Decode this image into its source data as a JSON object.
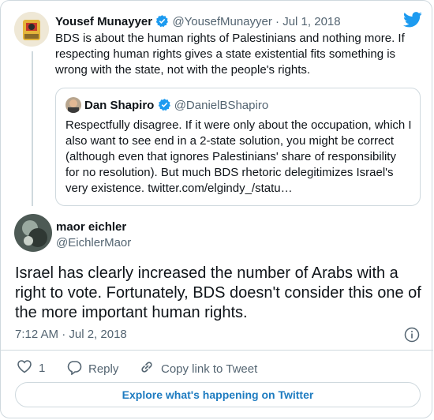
{
  "parent_tweet": {
    "display_name": "Yousef Munayyer",
    "handle": "@YousefMunayyer",
    "date": "Jul 1, 2018",
    "separator": "·",
    "text": "BDS is about the human rights of Palestinians and nothing more. If respecting human rights gives a state existential fits something is wrong with the state, not with the people's rights."
  },
  "quoted_tweet": {
    "display_name": "Dan Shapiro",
    "handle": "@DanielBShapiro",
    "text": "Respectfully disagree. If it were only about the occupation, which I also want to see end in a 2-state solution, you might be correct (although even that ignores Palestinians' share of responsibility for no resolution). But much BDS rhetoric delegitimizes Israel's very existence. twitter.com/elgindy_/statu…"
  },
  "main_tweet": {
    "display_name": "maor eichler",
    "handle": "@EichlerMaor",
    "text": "Israel has clearly increased the number of Arabs with a right to vote. Fortunately, BDS doesn't consider this one of the more important human rights.",
    "timestamp": "7:12 AM · Jul 2, 2018",
    "like_count": "1",
    "reply_label": "Reply",
    "copy_link_label": "Copy link to Tweet"
  },
  "explore_button": "Explore what's happening on Twitter",
  "icons": [
    "twitter-bird-icon",
    "verified-badge-icon",
    "info-icon",
    "heart-icon",
    "reply-icon",
    "link-icon"
  ],
  "colors": {
    "brand": "#1d9bf0",
    "text": "#0f1419",
    "muted": "#536471",
    "border": "#cfd9de"
  }
}
